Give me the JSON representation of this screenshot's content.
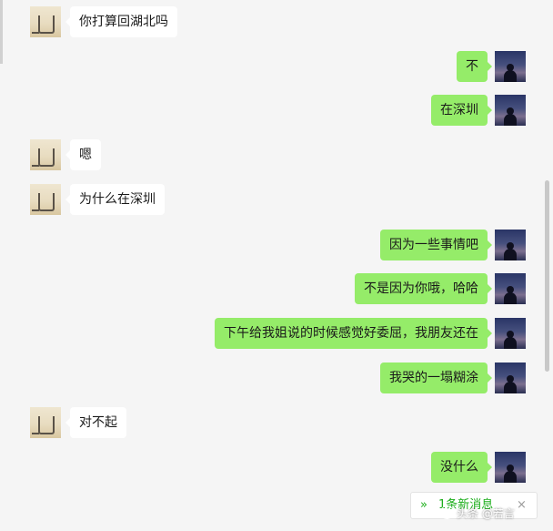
{
  "colors": {
    "background": "#f5f5f5",
    "sent_bubble": "#95ec69",
    "received_bubble": "#ffffff",
    "accent": "#1aad19"
  },
  "messages": [
    {
      "side": "left",
      "text": "你打算回湖北吗"
    },
    {
      "side": "right",
      "text": "不"
    },
    {
      "side": "right",
      "text": "在深圳"
    },
    {
      "side": "left",
      "text": "嗯"
    },
    {
      "side": "left",
      "text": "为什么在深圳"
    },
    {
      "side": "right",
      "text": "因为一些事情吧"
    },
    {
      "side": "right",
      "text": "不是因为你哦，哈哈"
    },
    {
      "side": "right",
      "text": "下午给我姐说的时候感觉好委屈，我朋友还在"
    },
    {
      "side": "right",
      "text": "我哭的一塌糊涂"
    },
    {
      "side": "left",
      "text": "对不起"
    },
    {
      "side": "right",
      "text": "没什么"
    }
  ],
  "new_message_banner": {
    "icon": "chevron-double-down-icon",
    "label": "1条新消息",
    "close": "×"
  },
  "watermark": {
    "text": "头条 @若言"
  }
}
